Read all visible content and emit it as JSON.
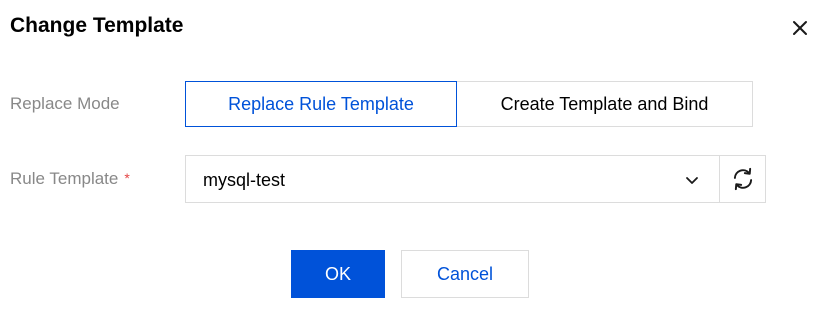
{
  "dialog": {
    "title": "Change Template",
    "close_icon": "close-icon"
  },
  "replace_mode": {
    "label": "Replace Mode",
    "options": [
      {
        "label": "Replace Rule Template",
        "selected": true
      },
      {
        "label": "Create Template and Bind",
        "selected": false
      }
    ]
  },
  "rule_template": {
    "label": "Rule Template",
    "required_mark": "*",
    "value": "mysql-test",
    "dropdown_icon": "chevron-down-icon",
    "refresh_icon": "refresh-icon"
  },
  "actions": {
    "ok_label": "OK",
    "cancel_label": "Cancel"
  },
  "colors": {
    "primary": "#0052d9",
    "required": "#e54545",
    "label": "#888888",
    "border": "#dcdcdc"
  }
}
